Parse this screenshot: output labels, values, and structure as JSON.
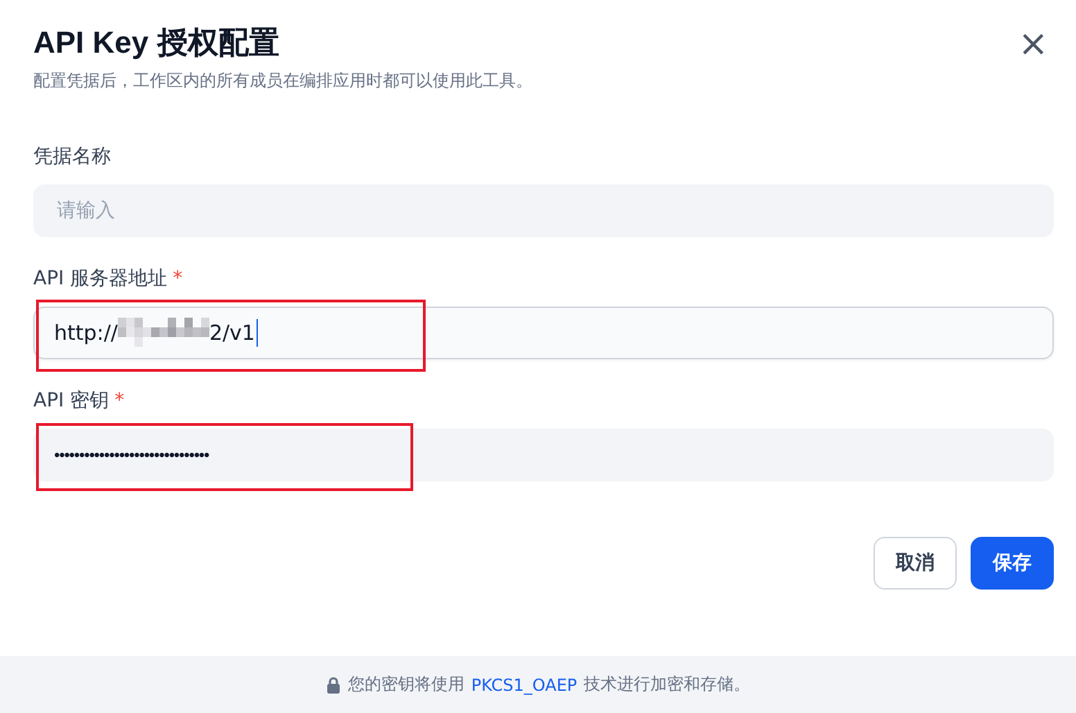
{
  "dialog": {
    "title": "API Key 授权配置",
    "subtitle": "配置凭据后，工作区内的所有成员在编排应用时都可以使用此工具。",
    "close": "×"
  },
  "fields": [
    {
      "label": "凭据名称",
      "kind": "text",
      "placeholder": "请输入",
      "highlighted": false,
      "focused": false
    },
    {
      "label": "API 服务器地址",
      "required_mark": "*",
      "kind": "redacted",
      "value_start": "http://",
      "value_end": "2/v1",
      "highlighted": true,
      "focused": true
    },
    {
      "label": "API 密钥",
      "required_mark": "*",
      "kind": "password",
      "value": "•••••••••••••••••••••••••••••••",
      "highlighted": true,
      "focused": false
    }
  ],
  "buttons": [
    {
      "label": "取消",
      "kind": "secondary"
    },
    {
      "label": "保存",
      "kind": "primary"
    }
  ],
  "footer": {
    "text_before": "您的密钥将使用",
    "link": "PKCS1_OAEP",
    "text_after": "技术进行加密和存储。"
  }
}
